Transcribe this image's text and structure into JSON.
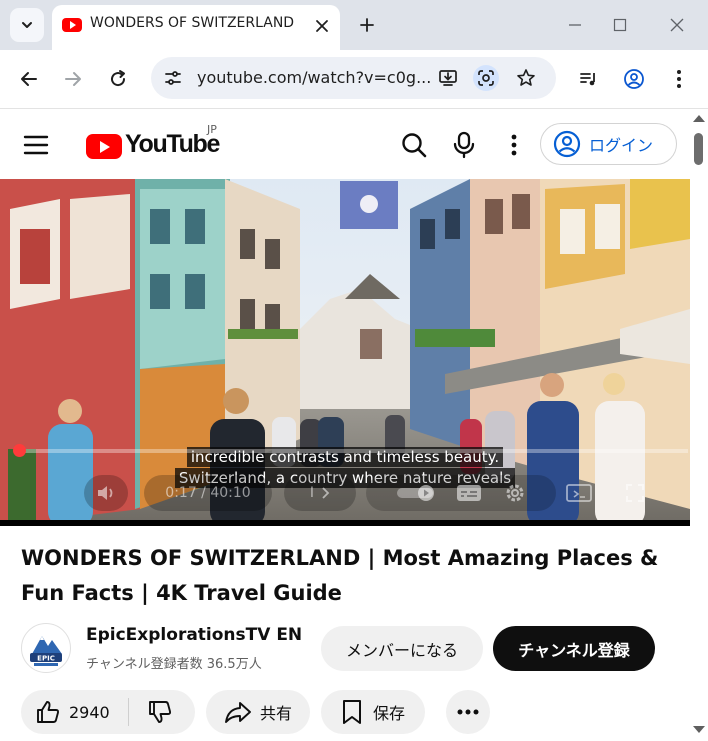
{
  "browser": {
    "tab": {
      "title": "WONDERS OF SWITZERLAND | Most Amazing Places & Fun Facts | 4K Travel Guide"
    },
    "address_bar": {
      "url": "youtube.com/watch?v=c0g..."
    },
    "icons": {
      "tab_search": "chevron-down-icon",
      "favicon": "youtube-favicon",
      "tab_close": "close-icon",
      "new_tab": "plus-icon",
      "minimize": "minimize-icon",
      "maximize": "maximize-icon",
      "close": "close-icon",
      "back": "back-arrow-icon",
      "forward": "forward-arrow-icon",
      "reload": "reload-icon",
      "site_info": "tune-icon",
      "install": "install-app-icon",
      "lens": "google-lens-icon",
      "bookmark": "star-icon",
      "media": "media-control-icon",
      "profile": "profile-icon",
      "menu": "kebab-icon"
    }
  },
  "header": {
    "logo_text": "YouTube",
    "region": "JP",
    "login_label": "ログイン"
  },
  "player": {
    "captions": [
      "incredible contrasts and timeless beauty.",
      "Switzerland, a country where nature reveals"
    ],
    "time": "0:17 / 40:10",
    "chapter_label": "I",
    "progress": 0.007,
    "colors": {
      "progress": "#ff0000"
    }
  },
  "video": {
    "title": "WONDERS OF SWITZERLAND | Most Amazing Places & Fun Facts | 4K Travel Guide",
    "channel": {
      "name": "EpicExplorationsTV EN",
      "subscribers": "チャンネル登録者数 36.5万人",
      "avatar_text": "EPIC"
    },
    "member_label": "メンバーになる",
    "subscribe_label": "チャンネル登録",
    "likes": "2940",
    "share_label": "共有",
    "save_label": "保存"
  }
}
